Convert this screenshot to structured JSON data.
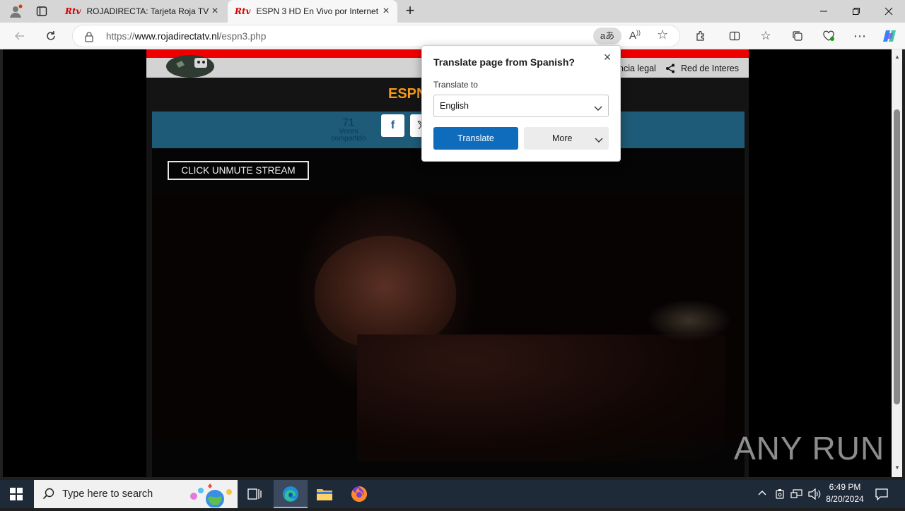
{
  "browser": {
    "tabs": [
      {
        "label": "ROJADIRECTA: Tarjeta Roja TV - P",
        "favicon": "Rtv",
        "active": false
      },
      {
        "label": "ESPN 3 HD En Vivo por Internet",
        "favicon": "Rtv",
        "active": true
      }
    ],
    "url_domain": "www.rojadirectatv.nl",
    "url_prefix": "https://",
    "url_path": "/espn3.php"
  },
  "site": {
    "nav_links": [
      "ncia legal",
      "Red de Interes"
    ],
    "page_heading": "ESPN",
    "share_count": "71",
    "share_label_1": "Veces",
    "share_label_2": "compartido",
    "facebook_label": "f",
    "x_label": "𝕏"
  },
  "player": {
    "unmute_label": "CLICK UNMUTE STREAM"
  },
  "translate_popup": {
    "title": "Translate page from Spanish?",
    "translate_to_label": "Translate to",
    "selected_language": "English",
    "translate_button": "Translate",
    "more_button": "More"
  },
  "taskbar": {
    "search_placeholder": "Type here to search",
    "time": "6:49 PM",
    "date": "8/20/2024"
  },
  "watermark": "ANY RUN",
  "colors": {
    "accent_blue": "#0f6cbd",
    "site_red": "#e00000",
    "heading_orange": "#f59a1a",
    "share_bar": "#1d5b78"
  }
}
